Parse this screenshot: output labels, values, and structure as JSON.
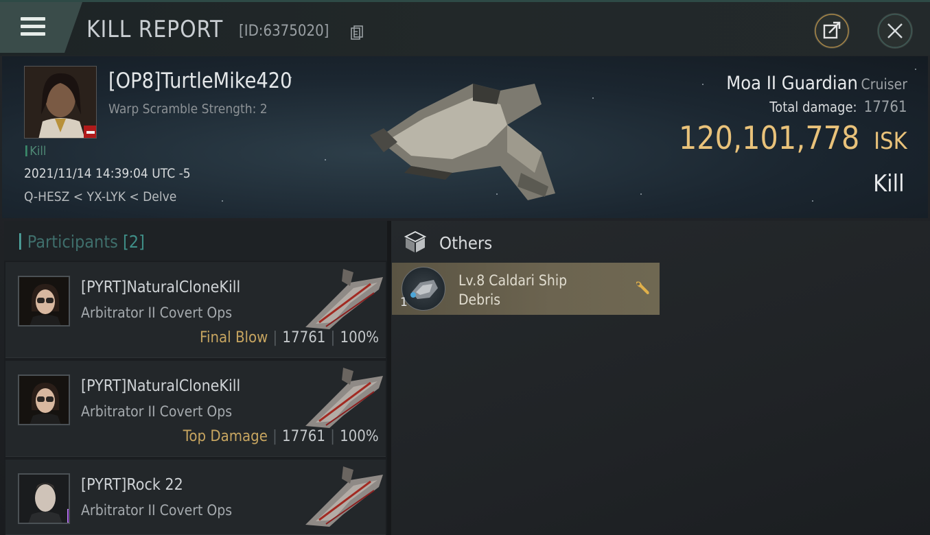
{
  "header": {
    "title": "KILL REPORT",
    "report_id": "[ID:6375020]"
  },
  "victim": {
    "name": "[OP8]TurtleMike420",
    "warp_scramble": "Warp Scramble Strength: 2",
    "kill_tag": "Kill",
    "datetime": "2021/11/14 14:39:04 UTC -5",
    "location": "Q-HESZ < YX-LYK < Delve",
    "ship_name": "Moa II Guardian",
    "ship_class": "Cruiser",
    "total_damage_label": "Total damage:",
    "total_damage": "17761",
    "isk_value": "120,101,778",
    "isk_unit": "ISK",
    "result": "Kill"
  },
  "participants": {
    "title": "Participants",
    "count": "[2]",
    "rows": [
      {
        "name": "[PYRT]NaturalCloneKill",
        "ship": "Arbitrator II Covert Ops",
        "tag": "Final Blow",
        "damage": "17761",
        "percent": "100%"
      },
      {
        "name": "[PYRT]NaturalCloneKill",
        "ship": "Arbitrator II Covert Ops",
        "tag": "Top Damage",
        "damage": "17761",
        "percent": "100%"
      },
      {
        "name": "[PYRT]Rock 22",
        "ship": "Arbitrator II Covert Ops",
        "tag": "",
        "damage": "",
        "percent": ""
      }
    ]
  },
  "others": {
    "title": "Others",
    "items": [
      {
        "qty": "1",
        "name_line1": "Lv.8 Caldari Ship",
        "name_line2": "Debris"
      }
    ]
  },
  "colors": {
    "accent_teal": "#3f8f88",
    "isk_gold": "#e9c27a",
    "tag_gold": "#c7a560",
    "item_card": "#6c6450"
  },
  "icons": {
    "menu": "hamburger-icon",
    "copy": "copy-icon",
    "share": "share-icon",
    "close": "close-icon",
    "others": "cube-icon",
    "item_action": "wrench-icon"
  }
}
